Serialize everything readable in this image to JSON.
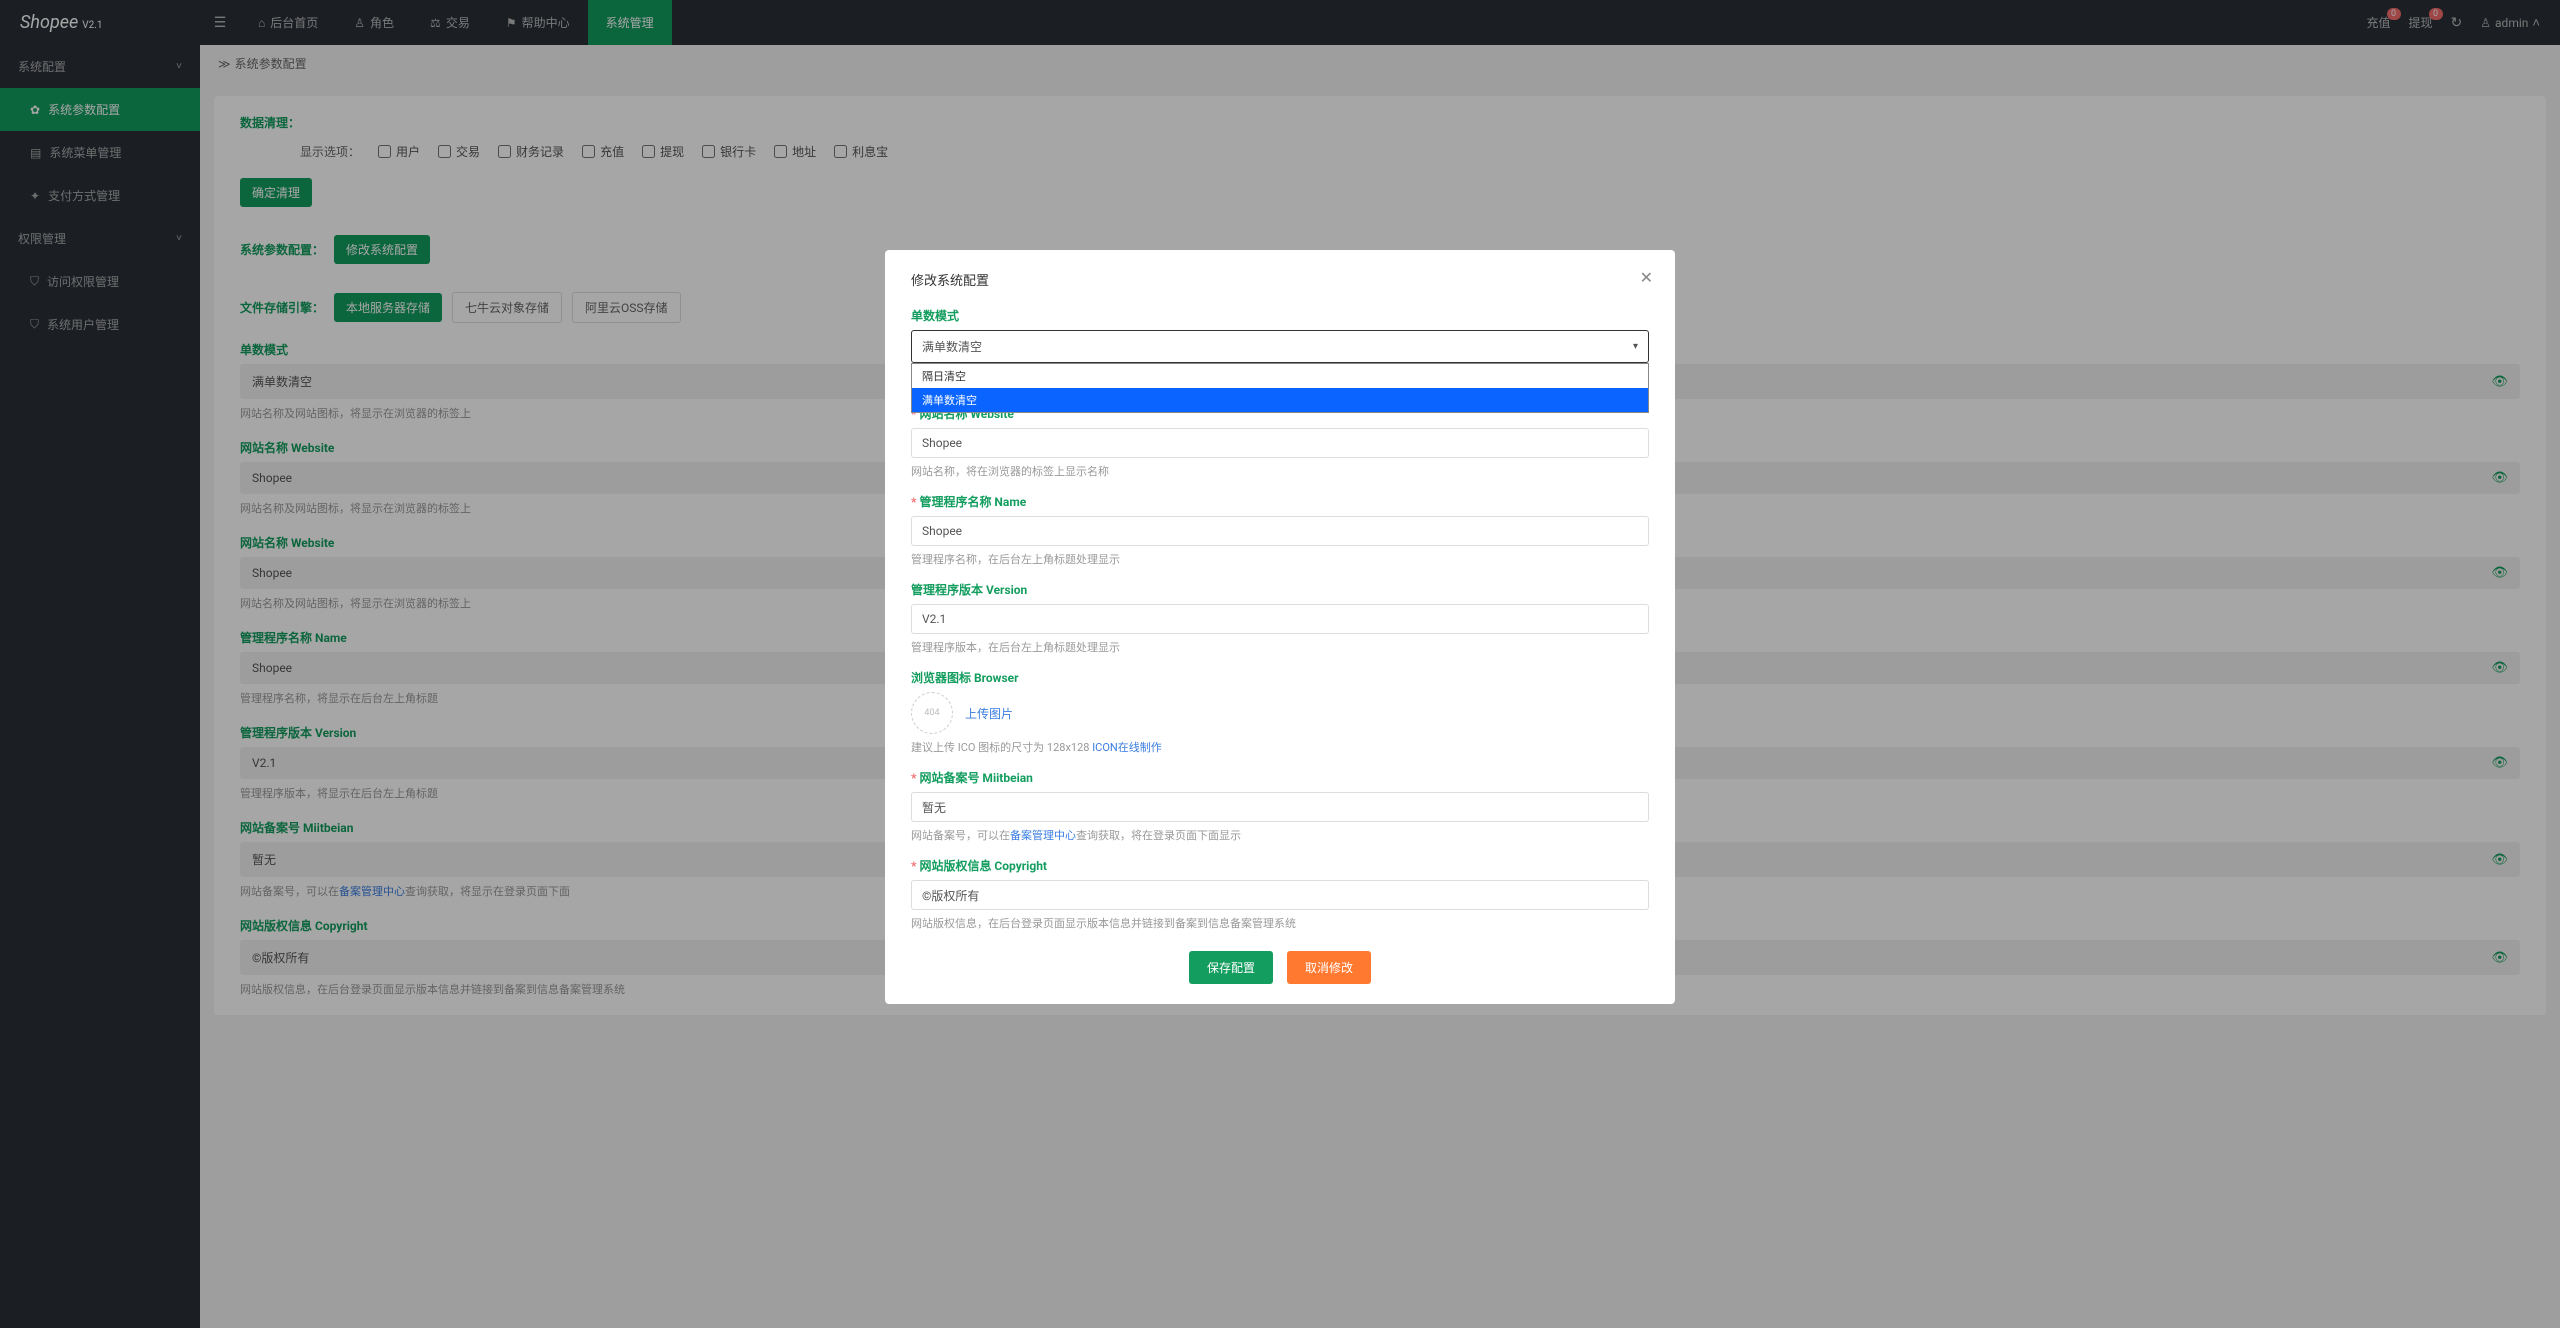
{
  "brand": {
    "name": "Shopee",
    "version": "V2.1"
  },
  "topnav": {
    "items": [
      {
        "icon": "home",
        "label": "后台首页"
      },
      {
        "icon": "user",
        "label": "角色"
      },
      {
        "icon": "trade",
        "label": "交易"
      },
      {
        "icon": "flag",
        "label": "帮助中心"
      },
      {
        "icon": "",
        "label": "系统管理"
      }
    ]
  },
  "topright": {
    "recharge": {
      "label": "充值",
      "badge": "0"
    },
    "withdraw": {
      "label": "提现",
      "badge": "0"
    },
    "user": "admin"
  },
  "sidebar": {
    "groups": [
      {
        "label": "系统配置",
        "expanded": true,
        "items": [
          {
            "label": "系统参数配置",
            "active": true,
            "icon": "gear"
          },
          {
            "label": "系统菜单管理",
            "icon": "menu"
          },
          {
            "label": "支付方式管理",
            "icon": "pay"
          }
        ]
      },
      {
        "label": "权限管理",
        "expanded": true,
        "items": [
          {
            "label": "访问权限管理",
            "icon": "lock"
          },
          {
            "label": "系统用户管理",
            "icon": "users"
          }
        ]
      }
    ]
  },
  "breadcrumb": {
    "text": "系统参数配置"
  },
  "data_clear": {
    "title": "数据清理：",
    "hint_label": "显示选项：",
    "options": [
      "用户",
      "交易",
      "财务记录",
      "充值",
      "提现",
      "银行卡",
      "地址",
      "利息宝"
    ],
    "confirm_btn": "确定清理"
  },
  "sys_config_bar": {
    "title": "系统参数配置：",
    "edit_btn": "修改系统配置"
  },
  "storage_bar": {
    "title": "文件存储引擎：",
    "opts": [
      "本地服务器存储",
      "七牛云对象存储",
      "阿里云OSS存储"
    ],
    "active": 0
  },
  "config_list": [
    {
      "key": "single_mode",
      "label": "单数模式",
      "value": "满单数清空",
      "hint": "网站名称及网站图标，将显示在浏览器的标签上"
    },
    {
      "key": "site_name",
      "label": "网站名称 Website",
      "value": "Shopee",
      "hint": "网站名称及网站图标，将显示在浏览器的标签上"
    },
    {
      "key": "site_name2",
      "label": "网站名称 Website",
      "value": "Shopee",
      "hint": "网站名称及网站图标，将显示在浏览器的标签上"
    },
    {
      "key": "mgr_name",
      "label": "管理程序名称 Name",
      "value": "Shopee",
      "hint": "管理程序名称，将显示在后台左上角标题"
    },
    {
      "key": "mgr_ver",
      "label": "管理程序版本 Version",
      "value": "V2.1",
      "hint": "管理程序版本，将显示在后台左上角标题"
    },
    {
      "key": "miit",
      "label": "网站备案号 Miitbeian",
      "value": "暂无",
      "hint_prefix": "网站备案号，可以在",
      "hint_link": "备案管理中心",
      "hint_suffix": "查询获取，将显示在登录页面下面"
    },
    {
      "key": "copyright",
      "label": "网站版权信息 Copyright",
      "value": "©版权所有",
      "hint": "网站版权信息，在后台登录页面显示版本信息并链接到备案到信息备案管理系统"
    }
  ],
  "modal": {
    "title": "修改系统配置",
    "select": {
      "label": "单数模式",
      "value": "满单数清空",
      "options": [
        "隔日清空",
        "满单数清空"
      ],
      "selected_index": 1
    },
    "site_name": {
      "label": "网站名称 Website",
      "value": "Shopee",
      "hint": "网站名称，将在浏览器的标签上显示名称"
    },
    "mgr_name": {
      "label": "管理程序名称 Name",
      "value": "Shopee",
      "hint": "管理程序名称，在后台左上角标题处理显示"
    },
    "mgr_ver": {
      "label": "管理程序版本 Version",
      "value": "V2.1",
      "hint": "管理程序版本，在后台左上角标题处理显示"
    },
    "browser_icon": {
      "label": "浏览器图标 Browser",
      "upload_text": "上传图片",
      "placeholder": "404",
      "hint_prefix": "建议上传 ICO 图标的尺寸为 128x128 ",
      "hint_link": "ICON在线制作"
    },
    "miit": {
      "label": "网站备案号 Miitbeian",
      "value": "暂无",
      "hint_prefix": "网站备案号，可以在",
      "hint_link": "备案管理中心",
      "hint_suffix": "查询获取，将在登录页面下面显示"
    },
    "copyright": {
      "label": "网站版权信息 Copyright",
      "value": "©版权所有",
      "hint": "网站版权信息，在后台登录页面显示版本信息并链接到备案到信息备案管理系统"
    },
    "save_btn": "保存配置",
    "cancel_btn": "取消修改"
  }
}
